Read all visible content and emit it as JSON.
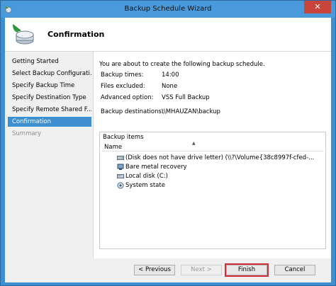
{
  "window": {
    "title": "Backup Schedule Wizard",
    "close_label": "✕"
  },
  "header": {
    "title": "Confirmation"
  },
  "nav": {
    "items": [
      {
        "label": "Getting Started",
        "state": "normal"
      },
      {
        "label": "Select Backup Configurati...",
        "state": "normal"
      },
      {
        "label": "Specify Backup Time",
        "state": "normal"
      },
      {
        "label": "Specify Destination Type",
        "state": "normal"
      },
      {
        "label": "Specify Remote Shared F...",
        "state": "normal"
      },
      {
        "label": "Confirmation",
        "state": "active"
      },
      {
        "label": "Summary",
        "state": "disabled"
      }
    ]
  },
  "content": {
    "intro": "You are about to create the following backup schedule.",
    "backup_times_label": "Backup times:",
    "backup_times_value": "14:00",
    "files_excluded_label": "Files excluded:",
    "files_excluded_value": "None",
    "advanced_option_label": "Advanced option:",
    "advanced_option_value": "VSS Full Backup",
    "destinations_label": "Backup destinations:",
    "destinations_value": "\\\\MHAUZAN\\backup",
    "items_title": "Backup items",
    "column_name": "Name",
    "items": [
      {
        "label": "(Disk does not have drive letter) (\\\\?\\Volume{38c8997f-cfed-...",
        "icon": "drive-icon"
      },
      {
        "label": "Bare metal recovery",
        "icon": "bare-metal-icon"
      },
      {
        "label": "Local disk (C:)",
        "icon": "local-disk-icon"
      },
      {
        "label": "System state",
        "icon": "system-state-icon"
      }
    ]
  },
  "footer": {
    "previous_label": "< Previous",
    "next_label": "Next >",
    "finish_label": "Finish",
    "cancel_label": "Cancel"
  }
}
